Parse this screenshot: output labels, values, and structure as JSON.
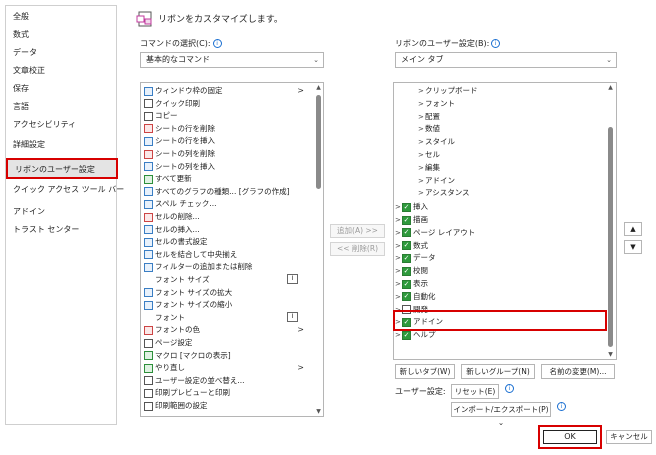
{
  "sidebar": {
    "items": [
      {
        "label": "全般"
      },
      {
        "label": "数式"
      },
      {
        "label": "データ"
      },
      {
        "label": "文章校正"
      },
      {
        "label": "保存"
      },
      {
        "label": "言語"
      },
      {
        "label": "アクセシビリティ"
      },
      {
        "label": "詳細設定"
      },
      {
        "label": "リボンのユーザー設定"
      },
      {
        "label": "クイック アクセス ツール バー"
      },
      {
        "label": "アドイン"
      },
      {
        "label": "トラスト センター"
      }
    ],
    "selected_index": 8
  },
  "header": {
    "title": "リボンをカスタマイズします。"
  },
  "left_panel": {
    "label": "コマンドの選択(C):",
    "dropdown_value": "基本的なコマンド",
    "commands": [
      {
        "label": "ウィンドウ枠の固定",
        "icon": "freeze-panes-icon",
        "arrow": ">"
      },
      {
        "label": "クイック印刷",
        "icon": "quick-print-icon"
      },
      {
        "label": "コピー",
        "icon": "copy-icon"
      },
      {
        "label": "シートの行を削除",
        "icon": "delete-row-icon"
      },
      {
        "label": "シートの行を挿入",
        "icon": "insert-row-icon"
      },
      {
        "label": "シートの列を削除",
        "icon": "delete-column-icon"
      },
      {
        "label": "シートの列を挿入",
        "icon": "insert-column-icon"
      },
      {
        "label": "すべて更新",
        "icon": "refresh-all-icon"
      },
      {
        "label": "すべてのグラフの種類... [グラフの作成]",
        "icon": "chart-icon"
      },
      {
        "label": "スペル チェック...",
        "icon": "spell-check-icon"
      },
      {
        "label": "セルの削除...",
        "icon": "delete-cell-icon"
      },
      {
        "label": "セルの挿入...",
        "icon": "insert-cell-icon"
      },
      {
        "label": "セルの書式設定",
        "icon": "format-cells-icon"
      },
      {
        "label": "セルを結合して中央揃え",
        "icon": "merge-center-icon"
      },
      {
        "label": "フィルターの追加または削除",
        "icon": "filter-icon"
      },
      {
        "label": "フォント サイズ",
        "icon": "blank",
        "badge": "I"
      },
      {
        "label": "フォント サイズの拡大",
        "icon": "font-grow-icon"
      },
      {
        "label": "フォント サイズの縮小",
        "icon": "font-shrink-icon"
      },
      {
        "label": "フォント",
        "icon": "blank",
        "badge": "I"
      },
      {
        "label": "フォントの色",
        "icon": "font-color-icon",
        "arrow": ">"
      },
      {
        "label": "ページ設定",
        "icon": "page-setup-icon"
      },
      {
        "label": "マクロ [マクロの表示]",
        "icon": "macro-icon"
      },
      {
        "label": "やり直し",
        "icon": "redo-icon",
        "arrow": ">"
      },
      {
        "label": "ユーザー設定の並べ替え...",
        "icon": "custom-sort-icon"
      },
      {
        "label": "印刷プレビューと印刷",
        "icon": "print-preview-icon"
      },
      {
        "label": "印刷範囲の設定",
        "icon": "print-area-icon"
      }
    ]
  },
  "middle": {
    "add_label": "追加(A) >>",
    "remove_label": "<< 削除(R)"
  },
  "right_panel": {
    "label": "リボンのユーザー設定(B):",
    "dropdown_value": "メイン タブ",
    "groups": [
      {
        "label": "クリップボード"
      },
      {
        "label": "フォント"
      },
      {
        "label": "配置"
      },
      {
        "label": "数値"
      },
      {
        "label": "スタイル"
      },
      {
        "label": "セル"
      },
      {
        "label": "編集"
      },
      {
        "label": "アドイン"
      },
      {
        "label": "アシスタンス"
      }
    ],
    "tabs": [
      {
        "label": "挿入",
        "checked": true
      },
      {
        "label": "描画",
        "checked": true
      },
      {
        "label": "ページ レイアウト",
        "checked": true
      },
      {
        "label": "数式",
        "checked": true
      },
      {
        "label": "データ",
        "checked": true
      },
      {
        "label": "校閲",
        "checked": true
      },
      {
        "label": "表示",
        "checked": true
      },
      {
        "label": "自動化",
        "checked": true
      },
      {
        "label": "開発",
        "checked": false
      },
      {
        "label": "アドイン",
        "checked": true
      },
      {
        "label": "ヘルプ",
        "checked": true
      }
    ],
    "new_tab_label": "新しいタブ(W)",
    "new_group_label": "新しいグループ(N)",
    "rename_label": "名前の変更(M)...",
    "user_settings_label": "ユーザー設定:",
    "reset_label": "リセット(E)",
    "import_export_label": "インポート/エクスポート(P)"
  },
  "footer": {
    "ok_label": "OK",
    "cancel_label": "キャンセル"
  }
}
